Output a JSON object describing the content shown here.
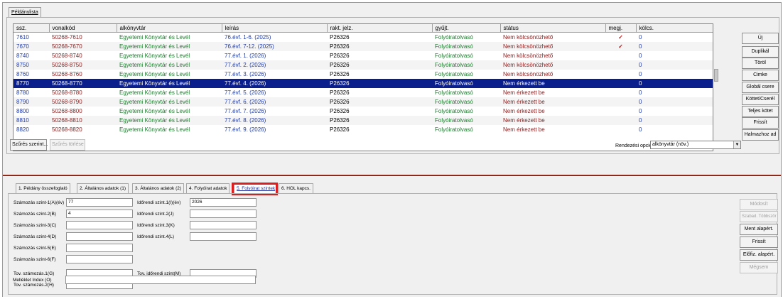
{
  "top_tab": "Példánylista",
  "columns": [
    "ssz.",
    "vonalkód",
    "alkönyvtár",
    "leírás",
    "rakt. jelz.",
    "gyűjt.",
    "státus",
    "megj.",
    "kölcs."
  ],
  "rows": [
    {
      "ssz": "7610",
      "vonalkod": "50268-7610",
      "alk": "Egyetemi Könyvtár és Levél",
      "leiras": "76.évf. 1-6. (2025)",
      "rakt": "P26326",
      "gyujt": "Folyóiratolvasó",
      "status": "Nem kölcsönözhető",
      "megj": "✓",
      "kolcs": "0"
    },
    {
      "ssz": "7670",
      "vonalkod": "50268-7670",
      "alk": "Egyetemi Könyvtár és Levél",
      "leiras": "76.évf. 7-12. (2025)",
      "rakt": "P26326",
      "gyujt": "Folyóiratolvasó",
      "status": "Nem kölcsönözhető",
      "megj": "✓",
      "kolcs": "0"
    },
    {
      "ssz": "8740",
      "vonalkod": "50268-8740",
      "alk": "Egyetemi Könyvtár és Levél",
      "leiras": "77.évf. 1. (2026)",
      "rakt": "P26326",
      "gyujt": "Folyóiratolvasó",
      "status": "Nem kölcsönözhető",
      "megj": "",
      "kolcs": "0"
    },
    {
      "ssz": "8750",
      "vonalkod": "50268-8750",
      "alk": "Egyetemi Könyvtár és Levél",
      "leiras": "77.évf. 2. (2026)",
      "rakt": "P26326",
      "gyujt": "Folyóiratolvasó",
      "status": "Nem kölcsönözhető",
      "megj": "",
      "kolcs": "0"
    },
    {
      "ssz": "8760",
      "vonalkod": "50268-8760",
      "alk": "Egyetemi Könyvtár és Levél",
      "leiras": "77.évf. 3. (2026)",
      "rakt": "P26326",
      "gyujt": "Folyóiratolvasó",
      "status": "Nem kölcsönözhető",
      "megj": "",
      "kolcs": "0"
    },
    {
      "ssz": "8770",
      "vonalkod": "50268-8770",
      "alk": "Egyetemi Könyvtár és Levél",
      "leiras": "77.évf. 4. (2026)",
      "rakt": "P26326",
      "gyujt": "Folyóiratolvasó",
      "status": "Nem érkezett be",
      "megj": "",
      "kolcs": "0"
    },
    {
      "ssz": "8780",
      "vonalkod": "50268-8780",
      "alk": "Egyetemi Könyvtár és Levél",
      "leiras": "77.évf. 5. (2026)",
      "rakt": "P26326",
      "gyujt": "Folyóiratolvasó",
      "status": "Nem érkezett be",
      "megj": "",
      "kolcs": "0"
    },
    {
      "ssz": "8790",
      "vonalkod": "50268-8790",
      "alk": "Egyetemi Könyvtár és Levél",
      "leiras": "77.évf. 6. (2026)",
      "rakt": "P26326",
      "gyujt": "Folyóiratolvasó",
      "status": "Nem érkezett be",
      "megj": "",
      "kolcs": "0"
    },
    {
      "ssz": "8800",
      "vonalkod": "50268-8800",
      "alk": "Egyetemi Könyvtár és Levél",
      "leiras": "77.évf. 7. (2026)",
      "rakt": "P26326",
      "gyujt": "Folyóiratolvasó",
      "status": "Nem érkezett be",
      "megj": "",
      "kolcs": "0"
    },
    {
      "ssz": "8810",
      "vonalkod": "50268-8810",
      "alk": "Egyetemi Könyvtár és Levél",
      "leiras": "77.évf. 8. (2026)",
      "rakt": "P26326",
      "gyujt": "Folyóiratolvasó",
      "status": "Nem érkezett be",
      "megj": "",
      "kolcs": "0"
    },
    {
      "ssz": "8820",
      "vonalkod": "50268-8820",
      "alk": "Egyetemi Könyvtár és Levél",
      "leiras": "77.évf. 9. (2026)",
      "rakt": "P26326",
      "gyujt": "Folyóiratolvasó",
      "status": "Nem érkezett be",
      "megj": "",
      "kolcs": "0"
    }
  ],
  "selected_row_index": 5,
  "filter_button": "Szűrés szerint...",
  "filter_clear_button": "Szűrés törlése",
  "side_buttons": {
    "uj": "Új",
    "duplikal": "Duplikál",
    "torol": "Töröl",
    "cimke": "Cimke",
    "global_csere": "Globál csere",
    "kottet": "Köttet/Cserél",
    "teljes_kotet": "Teljes kötet",
    "frissit": "Frissít",
    "halmazhoz": "Halmazhoz ad"
  },
  "sort": {
    "label": "Rendezési opciók",
    "value": "alkönyvtár (növ.)"
  },
  "bottom_tabs": [
    "1. Példány összefoglaló",
    "2. Általános adatok (1)",
    "3. Általános adatok (2)",
    "4. Folyóirat adatok",
    "5. Folyóirat szintek",
    "6. HOL kapcs."
  ],
  "active_bottom_tab": 4,
  "form": {
    "szam1_label": "Számozás szint-1(A)(év)",
    "szam1_value": "77",
    "szam2_label": "Számozás szint-2(B)",
    "szam2_value": "4",
    "szam3_label": "Számozás szint-3(C)",
    "szam4_label": "Számozás szint-4(D)",
    "szam5_label": "Számozás szint-5(E)",
    "szam6_label": "Számozás szint-6(F)",
    "ido1_label": "Időrendi szint.1(I)(év)",
    "ido1_value": "2026",
    "ido2_label": "Időrendi szint.2(J)",
    "ido3_label": "Időrendi szint.3(K)",
    "ido4_label": "Időrendi szint.4(L)",
    "tov_szam1_label": "Tov. számozás.1(G)",
    "tov_szam2_label": "Tov. számozás.2(H)",
    "tov_ido_label": "Tov. időrendi szint(M)",
    "melleklet_label": "Melléklet Index (O)"
  },
  "bottom_buttons": {
    "modosit": "Módosít",
    "szabad": "Szabad. Többször",
    "ment": "Ment alapért.",
    "frissit": "Frissít",
    "elofiz": "Előfiz. alapért.",
    "megsem": "Mégsem"
  }
}
